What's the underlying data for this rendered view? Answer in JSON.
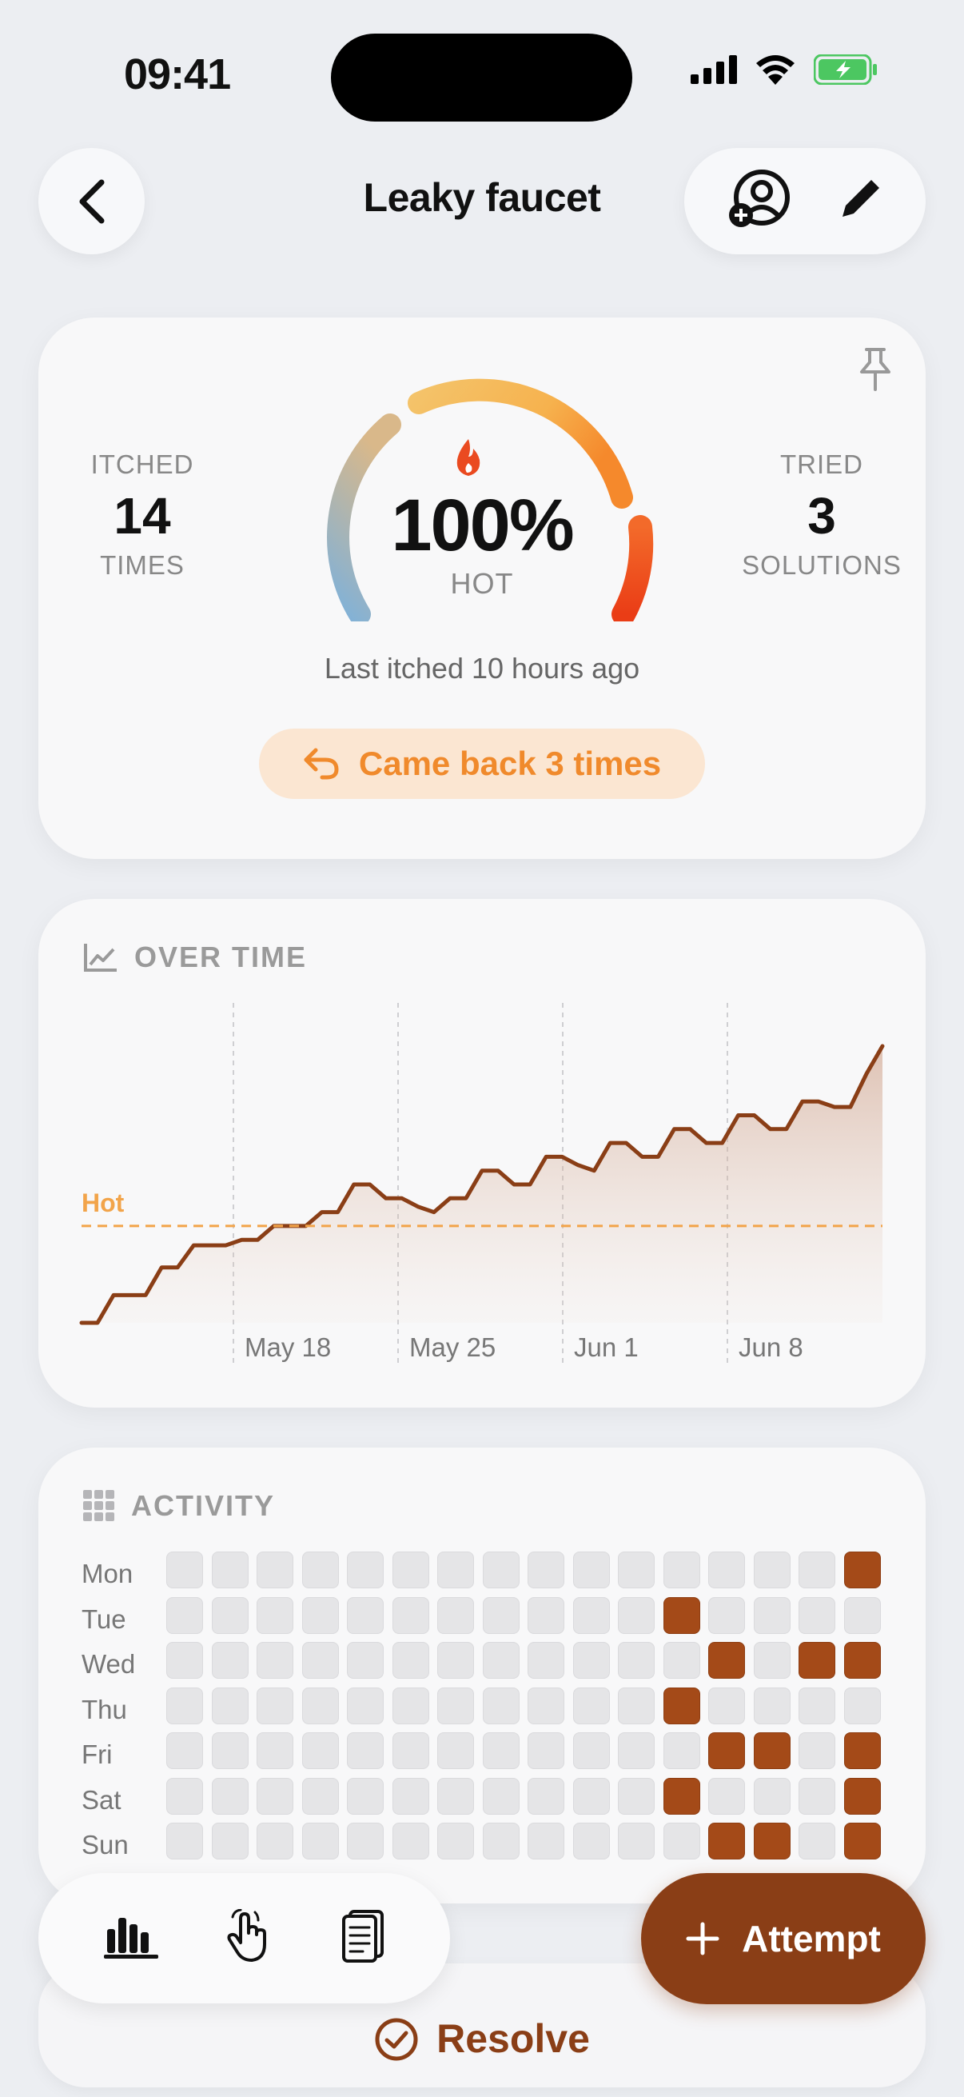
{
  "status": {
    "time": "09:41"
  },
  "nav": {
    "title": "Leaky faucet"
  },
  "stats": {
    "itched_label": "ITCHED",
    "itched_value": "14",
    "itched_unit": "TIMES",
    "tried_label": "TRIED",
    "tried_value": "3",
    "tried_unit": "SOLUTIONS",
    "gauge_value": "100%",
    "gauge_level": 1.0,
    "gauge_label": "HOT",
    "last_itched": "Last itched 10 hours ago",
    "came_back": "Came back 3 times"
  },
  "overtime": {
    "heading": "OVER TIME",
    "threshold_label": "Hot"
  },
  "chart_data": {
    "type": "area",
    "x_ticks": [
      "May 18",
      "May 25",
      "Jun 1",
      "Jun 8"
    ],
    "threshold": {
      "label": "Hot",
      "value": 35
    },
    "values": [
      0,
      0,
      10,
      10,
      10,
      20,
      20,
      28,
      28,
      28,
      30,
      30,
      35,
      35,
      35,
      40,
      40,
      50,
      50,
      45,
      45,
      42,
      40,
      45,
      45,
      55,
      55,
      50,
      50,
      60,
      60,
      57,
      55,
      65,
      65,
      60,
      60,
      70,
      70,
      65,
      65,
      75,
      75,
      70,
      70,
      80,
      80,
      78,
      78,
      90,
      100
    ],
    "ylim": [
      0,
      100
    ],
    "colors": {
      "line": "#8a3e16",
      "threshold": "#f2a44a"
    }
  },
  "activity": {
    "heading": "ACTIVITY",
    "days": [
      "Mon",
      "Tue",
      "Wed",
      "Thu",
      "Fri",
      "Sat",
      "Sun"
    ],
    "weeks": 16,
    "active": [
      [
        0,
        15
      ],
      [
        1,
        11
      ],
      [
        2,
        12
      ],
      [
        2,
        14
      ],
      [
        2,
        15
      ],
      [
        3,
        11
      ],
      [
        4,
        12
      ],
      [
        4,
        13
      ],
      [
        4,
        15
      ],
      [
        5,
        11
      ],
      [
        5,
        15
      ],
      [
        6,
        12
      ],
      [
        6,
        13
      ],
      [
        6,
        15
      ]
    ]
  },
  "bottom": {
    "resolve_label": "Resolve",
    "attempt_label": "Attempt"
  },
  "colors": {
    "accent": "#8a3e16",
    "orange": "#f08a2c",
    "hot_red": "#f04a1c"
  }
}
